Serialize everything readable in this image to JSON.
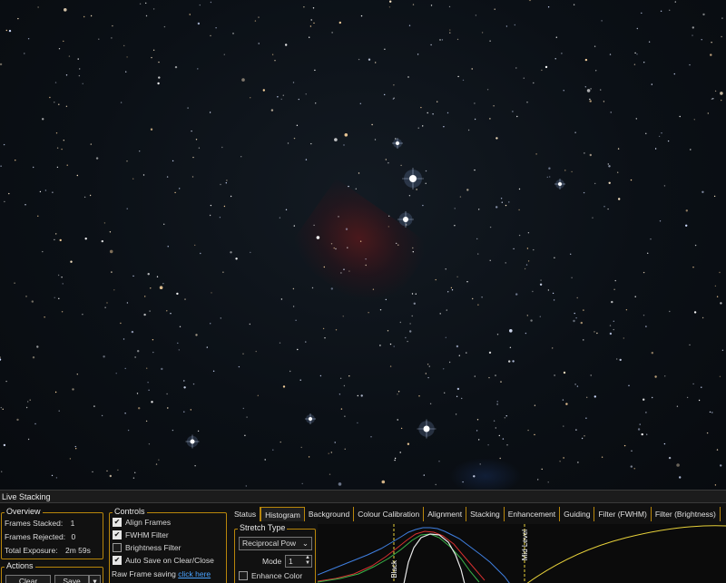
{
  "window": {
    "title": "Live Stacking"
  },
  "overview": {
    "title": "Overview",
    "frames_stacked_label": "Frames Stacked:",
    "frames_stacked": "1",
    "frames_rejected_label": "Frames Rejected:",
    "frames_rejected": "0",
    "total_exposure_label": "Total Exposure:",
    "total_exposure": "2m 59s"
  },
  "actions": {
    "title": "Actions",
    "clear_label": "Clear",
    "save_label": "Save"
  },
  "controls": {
    "title": "Controls",
    "align_frames": "Align Frames",
    "align_frames_checked": true,
    "fwhm_filter": "FWHM Filter",
    "fwhm_filter_checked": true,
    "brightness_filter": "Brightness Filter",
    "brightness_filter_checked": false,
    "auto_save": "Auto Save on Clear/Close",
    "auto_save_checked": true,
    "raw_frame_saving_label": "Raw Frame saving",
    "raw_frame_link": "click here"
  },
  "tabs": [
    "Status",
    "Histogram",
    "Background",
    "Colour Calibration",
    "Alignment",
    "Stacking",
    "Enhancement",
    "Guiding",
    "Filter (FWHM)",
    "Filter (Brightness)"
  ],
  "active_tab": "Histogram",
  "stretch": {
    "title": "Stretch Type",
    "type_value": "Reciprocal Pow",
    "mode_label": "Mode",
    "mode_value": "1",
    "enhance_color": "Enhance Color",
    "enhance_color_checked": false
  },
  "histogram": {
    "black_label": "Black",
    "mid_label": "Mid Level"
  },
  "colors": {
    "accent": "#b8860b",
    "link": "#4aa3ff",
    "curve": "#e8d23a",
    "hist_blue": "#3f7fe0"
  }
}
